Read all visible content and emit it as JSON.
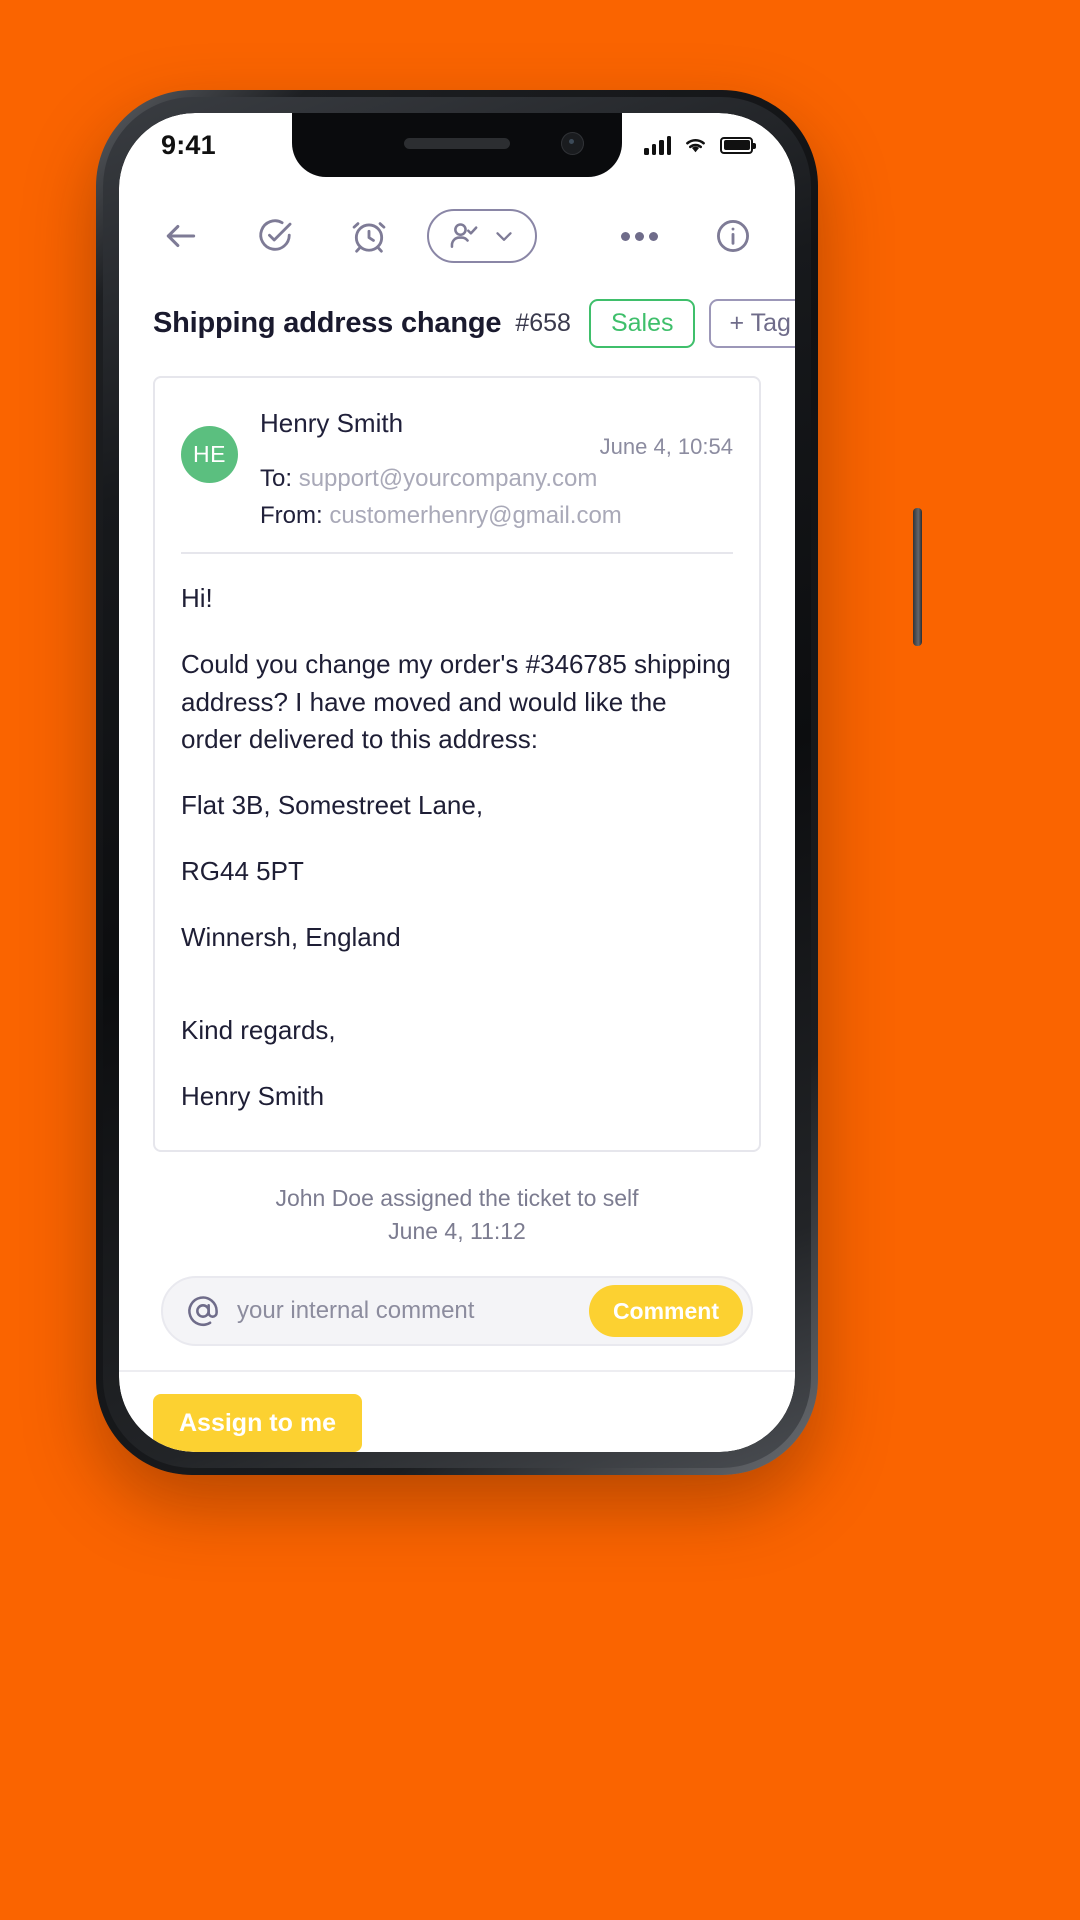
{
  "status_bar": {
    "time": "9:41",
    "signal_icon": "cellular-signal-icon",
    "wifi_icon": "wifi-icon",
    "battery_icon": "battery-icon"
  },
  "toolbar": {
    "back_icon": "back-arrow-icon",
    "resolve_icon": "check-circle-icon",
    "snooze_icon": "alarm-clock-icon",
    "assignee_icon": "person-check-icon",
    "assignee_chevron_icon": "chevron-down-icon",
    "more_icon": "more-horizontal-icon",
    "info_icon": "info-circle-icon"
  },
  "ticket": {
    "title": "Shipping address change",
    "number": "#658",
    "tag": "Sales",
    "add_tag": "+ Tag"
  },
  "email": {
    "avatar_initials": "HE",
    "sender_name": "Henry Smith",
    "to_label": "To:",
    "to_address": "support@yourcompany.com",
    "from_label": "From:",
    "from_address": "customerhenry@gmail.com",
    "timestamp": "June 4, 10:54",
    "body": [
      "Hi!",
      "Could you change my order's #346785 shipping address? I have moved and would like the order delivered to this address:",
      "Flat 3B, Somestreet Lane,",
      "RG44 5PT",
      "Winnersh, England",
      "Kind regards,",
      "Henry Smith"
    ]
  },
  "system_note": {
    "text": "John Doe assigned the ticket to self",
    "timestamp": "June 4, 11:12"
  },
  "comment": {
    "at_icon": "at-mention-icon",
    "placeholder": "your internal comment",
    "value": "",
    "submit_label": "Comment"
  },
  "footer": {
    "assign_label": "Assign to me"
  },
  "colors": {
    "background": "#FA6400",
    "accent_yellow": "#FCD131",
    "tag_green": "#3FBF6B",
    "avatar_green": "#5BBF7F",
    "icon_purple": "#7E7B96"
  }
}
